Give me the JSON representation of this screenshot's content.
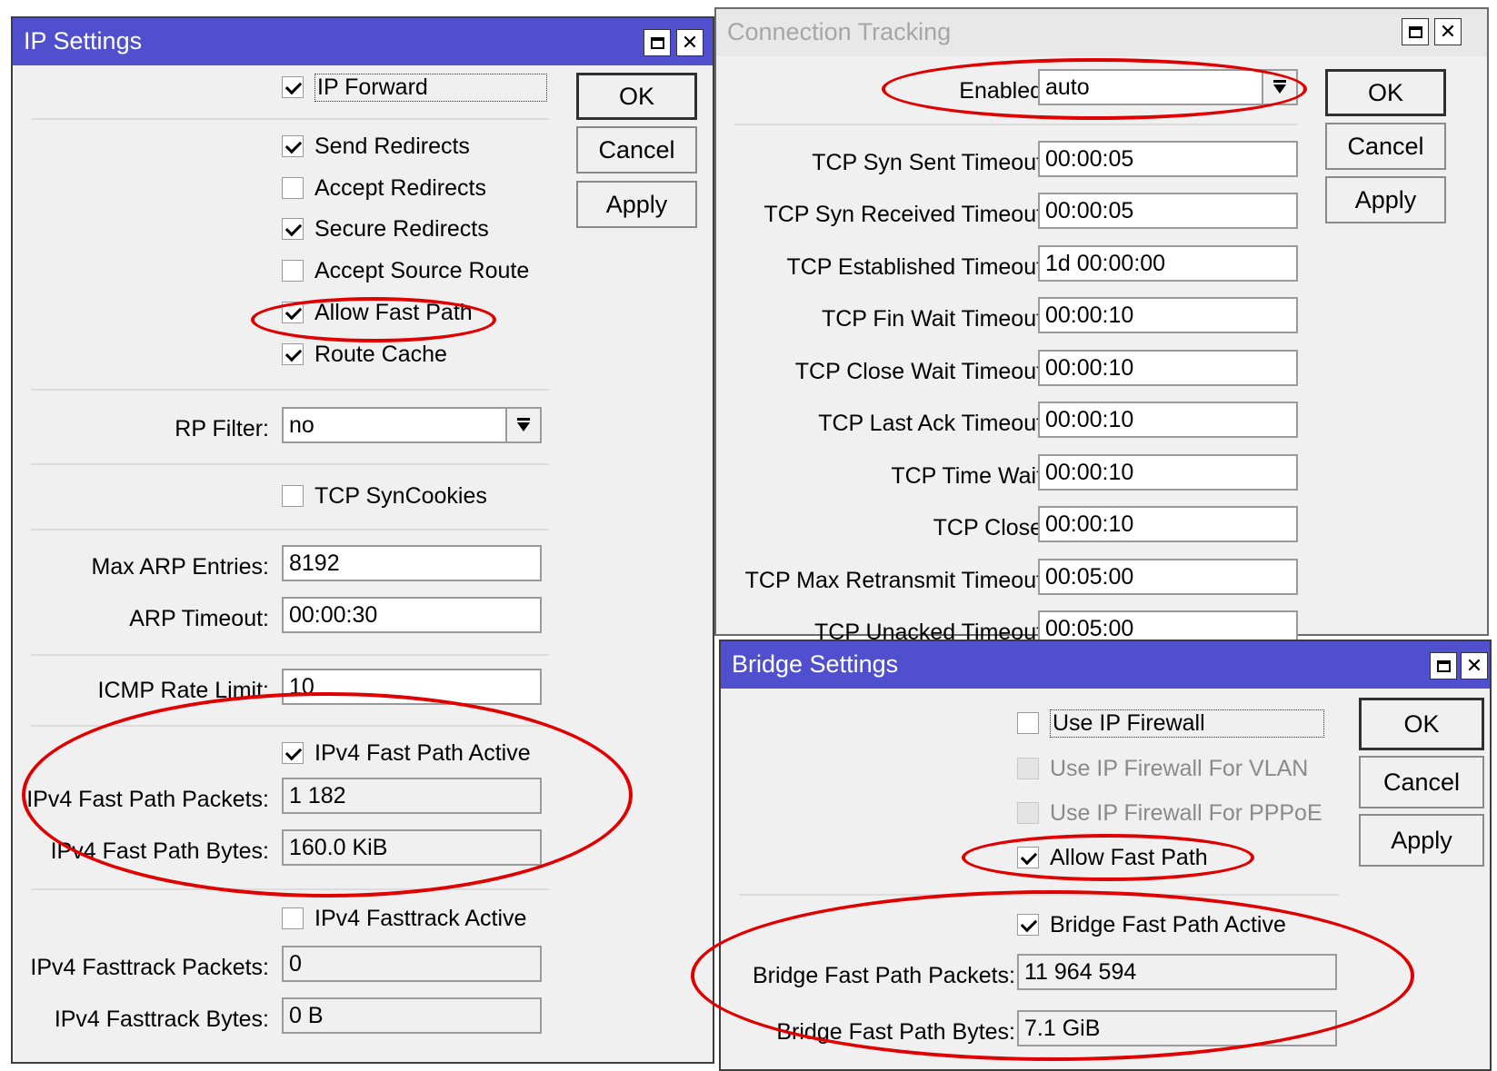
{
  "ip_settings": {
    "title": "IP Settings",
    "buttons": {
      "ok": "OK",
      "cancel": "Cancel",
      "apply": "Apply"
    },
    "checkboxes": {
      "ip_forward": {
        "label": "IP Forward",
        "checked": true
      },
      "send_redirects": {
        "label": "Send Redirects",
        "checked": true
      },
      "accept_redirects": {
        "label": "Accept Redirects",
        "checked": false
      },
      "secure_redirects": {
        "label": "Secure Redirects",
        "checked": true
      },
      "accept_source_route": {
        "label": "Accept Source Route",
        "checked": false
      },
      "allow_fast_path": {
        "label": "Allow Fast Path",
        "checked": true
      },
      "route_cache": {
        "label": "Route Cache",
        "checked": true
      },
      "tcp_syncookies": {
        "label": "TCP SynCookies",
        "checked": false
      },
      "ipv4_fast_path_active": {
        "label": "IPv4 Fast Path Active",
        "checked": true
      },
      "ipv4_fasttrack_active": {
        "label": "IPv4 Fasttrack Active",
        "checked": false
      }
    },
    "rp_filter": {
      "label": "RP Filter:",
      "value": "no"
    },
    "max_arp_entries": {
      "label": "Max ARP Entries:",
      "value": "8192"
    },
    "arp_timeout": {
      "label": "ARP Timeout:",
      "value": "00:00:30"
    },
    "icmp_rate_limit": {
      "label": "ICMP Rate Limit:",
      "value": "10"
    },
    "ipv4_fast_path_packets": {
      "label": "IPv4 Fast Path Packets:",
      "value": "1 182"
    },
    "ipv4_fast_path_bytes": {
      "label": "IPv4 Fast Path Bytes:",
      "value": "160.0 KiB"
    },
    "ipv4_fasttrack_packets": {
      "label": "IPv4 Fasttrack Packets:",
      "value": "0"
    },
    "ipv4_fasttrack_bytes": {
      "label": "IPv4 Fasttrack Bytes:",
      "value": "0 B"
    }
  },
  "connection_tracking": {
    "title": "Connection Tracking",
    "buttons": {
      "ok": "OK",
      "cancel": "Cancel",
      "apply": "Apply"
    },
    "enabled": {
      "label": "Enabled:",
      "value": "auto"
    },
    "fields": [
      {
        "label": "TCP Syn Sent Timeout:",
        "value": "00:00:05"
      },
      {
        "label": "TCP Syn Received Timeout:",
        "value": "00:00:05"
      },
      {
        "label": "TCP Established Timeout:",
        "value": "1d 00:00:00"
      },
      {
        "label": "TCP Fin Wait Timeout:",
        "value": "00:00:10"
      },
      {
        "label": "TCP Close Wait Timeout:",
        "value": "00:00:10"
      },
      {
        "label": "TCP Last Ack Timeout:",
        "value": "00:00:10"
      },
      {
        "label": "TCP Time Wait:",
        "value": "00:00:10"
      },
      {
        "label": "TCP Close:",
        "value": "00:00:10"
      },
      {
        "label": "TCP Max Retransmit Timeout:",
        "value": "00:05:00"
      },
      {
        "label": "TCP Unacked Timeout:",
        "value": "00:05:00"
      }
    ]
  },
  "bridge_settings": {
    "title": "Bridge Settings",
    "buttons": {
      "ok": "OK",
      "cancel": "Cancel",
      "apply": "Apply"
    },
    "checkboxes": {
      "use_ip_firewall": {
        "label": "Use IP Firewall",
        "checked": false
      },
      "use_ip_firewall_vlan": {
        "label": "Use IP Firewall For VLAN",
        "checked": false
      },
      "use_ip_firewall_pppoe": {
        "label": "Use IP Firewall For PPPoE",
        "checked": false
      },
      "allow_fast_path": {
        "label": "Allow Fast Path",
        "checked": true
      },
      "bridge_fast_path_active": {
        "label": "Bridge Fast Path Active",
        "checked": true
      }
    },
    "bridge_fast_path_packets": {
      "label": "Bridge Fast Path Packets:",
      "value": "11 964 594"
    },
    "bridge_fast_path_bytes": {
      "label": "Bridge Fast Path Bytes:",
      "value": "7.1 GiB"
    }
  },
  "colors": {
    "titlebar": "#5050ce",
    "window_bg": "#f0f0f0",
    "highlight_circle": "#e00000"
  },
  "icons": {
    "maximize": "maximize-icon",
    "close": "close-icon",
    "dropdown": "dropdown-arrow-icon",
    "checkbox": "checkbox-icon"
  }
}
